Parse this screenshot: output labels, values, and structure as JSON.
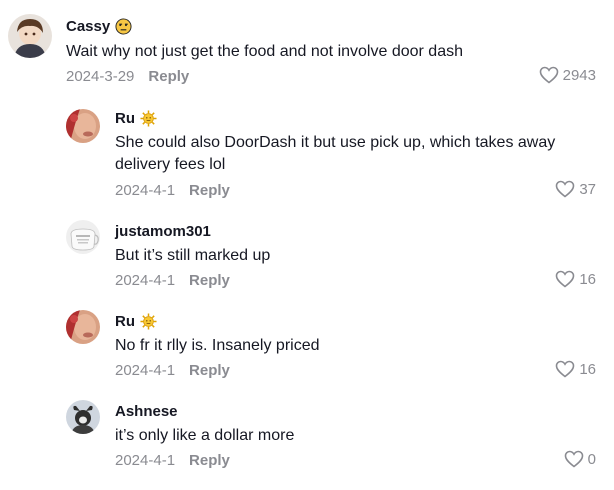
{
  "comments": [
    {
      "name": "Cassy",
      "emoji": "unamused-face-emoji",
      "text": "Wait why not just get the food and not involve door dash",
      "date": "2024-3-29",
      "reply": "Reply",
      "likes": "2943"
    },
    {
      "name": "Ru",
      "emoji": "sun-face-emoji",
      "text": "She could also DoorDash it but use pick up, which takes away delivery fees lol",
      "date": "2024-4-1",
      "reply": "Reply",
      "likes": "37"
    },
    {
      "name": "justamom301",
      "text": "But it’s still marked up",
      "date": "2024-4-1",
      "reply": "Reply",
      "likes": "16"
    },
    {
      "name": "Ru",
      "emoji": "sun-face-emoji",
      "text": "No fr it rlly is. Insanely priced",
      "date": "2024-4-1",
      "reply": "Reply",
      "likes": "16"
    },
    {
      "name": "Ashnese",
      "text": "it’s only like a dollar more",
      "date": "2024-4-1",
      "reply": "Reply",
      "likes": "0"
    }
  ],
  "colors": {
    "text": "#161823",
    "muted": "#8a8b91"
  }
}
